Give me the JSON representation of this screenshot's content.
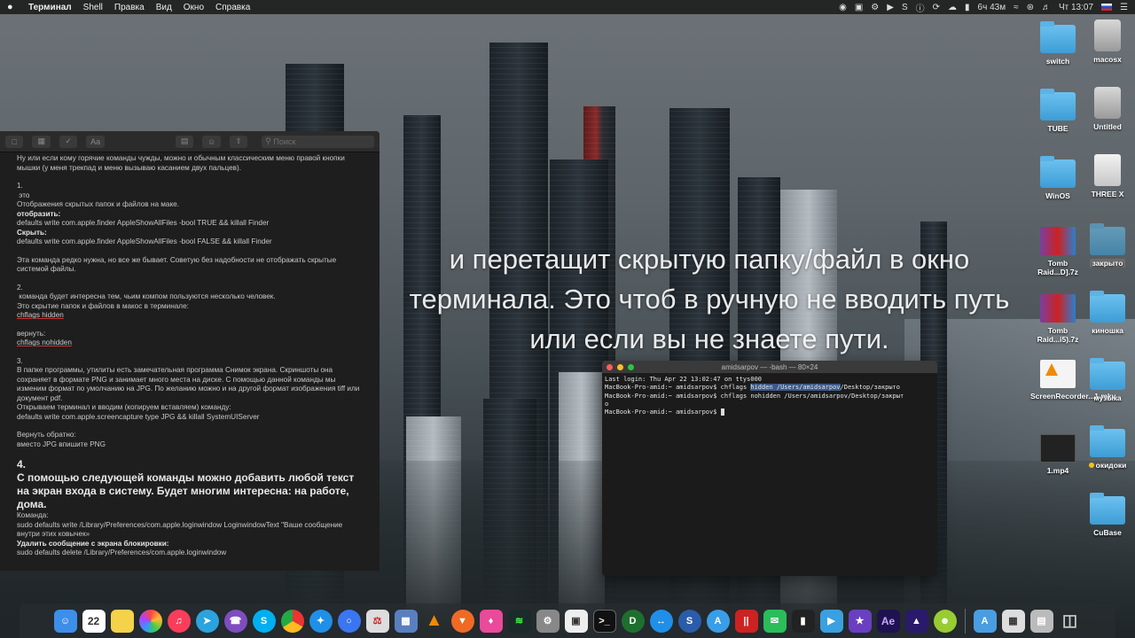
{
  "menubar": {
    "app_name": "Терминал",
    "menus": [
      "Shell",
      "Правка",
      "Вид",
      "Окно",
      "Справка"
    ],
    "battery": "6ч 43м",
    "clock": "Чт 13:07"
  },
  "notes": {
    "search_placeholder": "Поиск",
    "line1": "Ну или если кому горячие команды чужды, можно и обычным классическим меню правой кнопки мышки (у меня трекпад и меню вызываю касанием двух пальцев).",
    "n1": "1.",
    "n1_title": " это",
    "n1_desc": "Отображения скрытых папок и файлов на маке.",
    "show_label": "отобразить:",
    "show_cmd": "defaults write com.apple.finder AppleShowAllFiles -bool TRUE && killall Finder",
    "hide_label": "Скрыть:",
    "hide_cmd": "defaults write com.apple.finder AppleShowAllFiles -bool FALSE && killall Finder",
    "n1_note": "Эта команда редко нужна, но все же бывает. Советую без надобности не отображать скрытые системой файлы.",
    "n2": "2.",
    "n2_title": " команда будет интересна тем, чьим компом пользуются несколько человек.",
    "n2_desc": "Это скрытие папок и файлов в макос в терминале:",
    "n2_cmd": "chflags hidden",
    "n2_back": "вернуть:",
    "n2_back_cmd": "chflags nohidden",
    "n3": "3.",
    "n3_desc": "В папке программы, утилиты есть замечательная программа Снимок экрана. Скриншоты она сохраняет в формате PNG и занимает много места на диске. С помощью данной команды мы изменим формат по умолчанию на JPG. По желанию можно и на другой формат изображения tiff или документ pdf.",
    "n3_open": "Открываем терминал и вводим (копируем вставляем) команду:",
    "n3_cmd": "defaults write com.apple.screencapture type JPG && killall SystemUIServer",
    "n3_back": "Вернуть обратно:",
    "n3_back_desc": "вместо JPG впишите PNG",
    "n4": "4.",
    "n4_title": "С помощью следующей команды можно добавить любой текст на экран входа в систему. Будет многим интересна: на работе, дома.",
    "n4_cmd_label": "Команда:",
    "n4_cmd": "sudo defaults write /Library/Preferences/com.apple.loginwindow LoginwindowText \"Ваше сообщение внутри этих ковычек»",
    "n4_remove": "Удалить сообщение с экрана блокировки:",
    "n4_remove_cmd": "sudo defaults delete /Library/Preferences/com.apple.loginwindow"
  },
  "caption": "и перетащит скрытую папку/файл в окно терминала. Это чтоб в ручную не вводить путь или если вы не знаете пути.",
  "terminal": {
    "title": "amidsarpov — -bash — 80×24",
    "line1": "Last login: Thu Apr 22 13:02:47 on ttys000",
    "prompt": "MacBook-Pro-amid:~ amidsarpov$ ",
    "cmd1_a": "chflags ",
    "cmd1_sel": "hidden /Users/amidsarpov",
    "cmd1_b": "/Desktop/закрыто",
    "cmd2": "chflags nohidden /Users/amidsarpov/Desktop/закрыт",
    "cmd2_wrap": "о"
  },
  "desktop_icons": [
    {
      "label": "switch"
    },
    {
      "label": "macosx"
    },
    {
      "label": "TUBE"
    },
    {
      "label": "Untitled"
    },
    {
      "label": "WinOS"
    },
    {
      "label": "THREE X"
    },
    {
      "label": "Tomb Raid...D].7z"
    },
    {
      "label": "закрыто"
    },
    {
      "label": "Tomb Raid...i5).7z"
    },
    {
      "label": "киношка"
    },
    {
      "label": "ScreenRecorder...1.mkv"
    },
    {
      "label": "музыка"
    },
    {
      "label": "1.mp4"
    },
    {
      "label": "окидоки"
    },
    {
      "label": "CuBase"
    }
  ],
  "dock": {
    "calendar_day": "22",
    "ae_label": "Ae",
    "colors": {
      "finder": "#3d8ee8",
      "calendar": "#ffffff",
      "notes": "#f5d24a",
      "photos": "#f0a020",
      "music": "#fa3d5a",
      "telegram": "#2aa3de",
      "viber": "#7f4dbf",
      "skype": "#00aff0",
      "chrome": "#e8a822",
      "safari": "#1f8fe8",
      "signal": "#3a76f0",
      "vlc": "#f08a00",
      "brave": "#f06a24",
      "terminal": "#111111",
      "ae": "#1f1250"
    }
  }
}
